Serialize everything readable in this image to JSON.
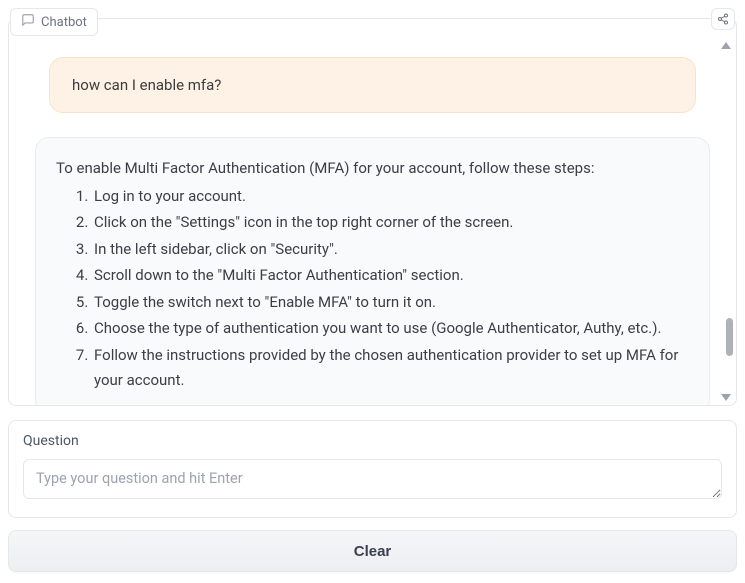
{
  "header": {
    "title": "Chatbot"
  },
  "chat": {
    "user_message": "how can I enable mfa?",
    "bot_intro": "To enable Multi Factor Authentication (MFA) for your account, follow these steps:",
    "bot_steps": [
      "Log in to your account.",
      "Click on the \"Settings\" icon in the top right corner of the screen.",
      "In the left sidebar, click on \"Security\".",
      "Scroll down to the \"Multi Factor Authentication\" section.",
      "Toggle the switch next to \"Enable MFA\" to turn it on.",
      "Choose the type of authentication you want to use (Google Authenticator, Authy, etc.).",
      "Follow the instructions provided by the chosen authentication provider to set up MFA for your account."
    ]
  },
  "input": {
    "label": "Question",
    "placeholder": "Type your question and hit Enter"
  },
  "buttons": {
    "clear": "Clear"
  }
}
